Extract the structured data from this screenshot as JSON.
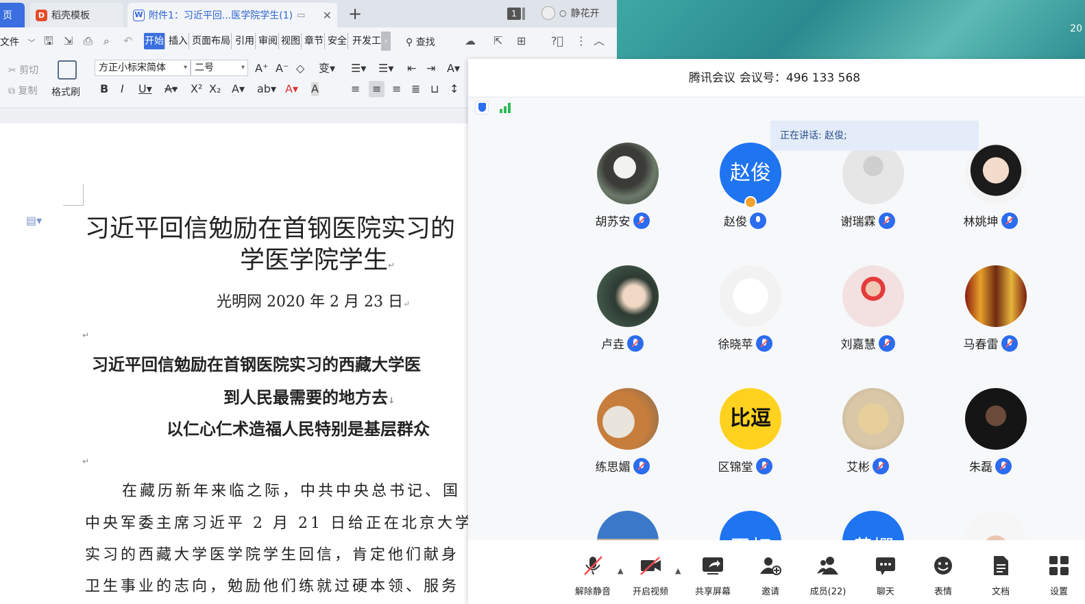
{
  "wps": {
    "tabs": {
      "home": "页",
      "docer": "稻壳模板",
      "active_doc": "附件1：习近平回...医学院学生(1)"
    },
    "window_count": "1",
    "user_name": "静花开",
    "menu": {
      "file": "文件",
      "tabs": [
        "开始",
        "插入",
        "页面布局",
        "引用",
        "审阅",
        "视图",
        "章节",
        "安全",
        "开发工"
      ],
      "find": "查找"
    },
    "ribbon": {
      "cut": "剪切",
      "copy": "复制",
      "format_brush": "格式刷",
      "font_name": "方正小标宋简体",
      "font_size": "二号"
    },
    "document": {
      "title_line1": "习近平回信勉励在首钢医院实习的",
      "title_line2": "学医学院学生",
      "source_line": "光明网  2020 年 2 月 23 日",
      "headline1": "习近平回信勉励在首钢医院实习的西藏大学医",
      "headline2": "到人民最需要的地方去",
      "headline3": "以仁心仁术造福人民特别是基层群众",
      "body1": "在藏历新年来临之际，中共中央总书记、国",
      "body2": "中央军委主席习近平 2 月 21 日给正在北京大学",
      "body3": "实习的西藏大学医学院学生回信，肯定他们献身",
      "body4": "卫生事业的志向，勉励他们练就过硬本领、服务"
    }
  },
  "desktop": {
    "clock": "20"
  },
  "meeting": {
    "title_app": "腾讯会议",
    "title_id_label": "会议号：",
    "title_id": "496 133 568",
    "speaking_banner": "正在讲话: 赵俊;",
    "participants": [
      {
        "name": "胡苏安",
        "mic": "muted"
      },
      {
        "name": "赵俊",
        "avatar_text": "赵俊",
        "mic": "on",
        "host": true
      },
      {
        "name": "谢瑞霖",
        "mic": "muted"
      },
      {
        "name": "林姚坤",
        "mic": "muted"
      },
      {
        "name": "卢垚",
        "mic": "muted"
      },
      {
        "name": "徐晓苹",
        "mic": "muted"
      },
      {
        "name": "刘嘉慧",
        "mic": "muted"
      },
      {
        "name": "马春雷",
        "mic": "muted"
      },
      {
        "name": "练思媚",
        "mic": "muted"
      },
      {
        "name": "区锦堂",
        "avatar_text": "比逗",
        "mic": "muted"
      },
      {
        "name": "艾彬",
        "mic": "muted"
      },
      {
        "name": "朱磊",
        "mic": "muted"
      }
    ],
    "partial_row_avatar_texts": [
      "",
      "王虹",
      "黄嫻",
      ""
    ],
    "controls": {
      "unmute": "解除静音",
      "start_video": "开启视频",
      "share_screen": "共享屏幕",
      "invite": "邀请",
      "members": "成员(22)",
      "chat": "聊天",
      "reactions": "表情",
      "docs": "文档",
      "settings": "设置"
    },
    "colors": {
      "accent": "#2b6cf0",
      "muted_red": "#ff5a5a"
    }
  }
}
